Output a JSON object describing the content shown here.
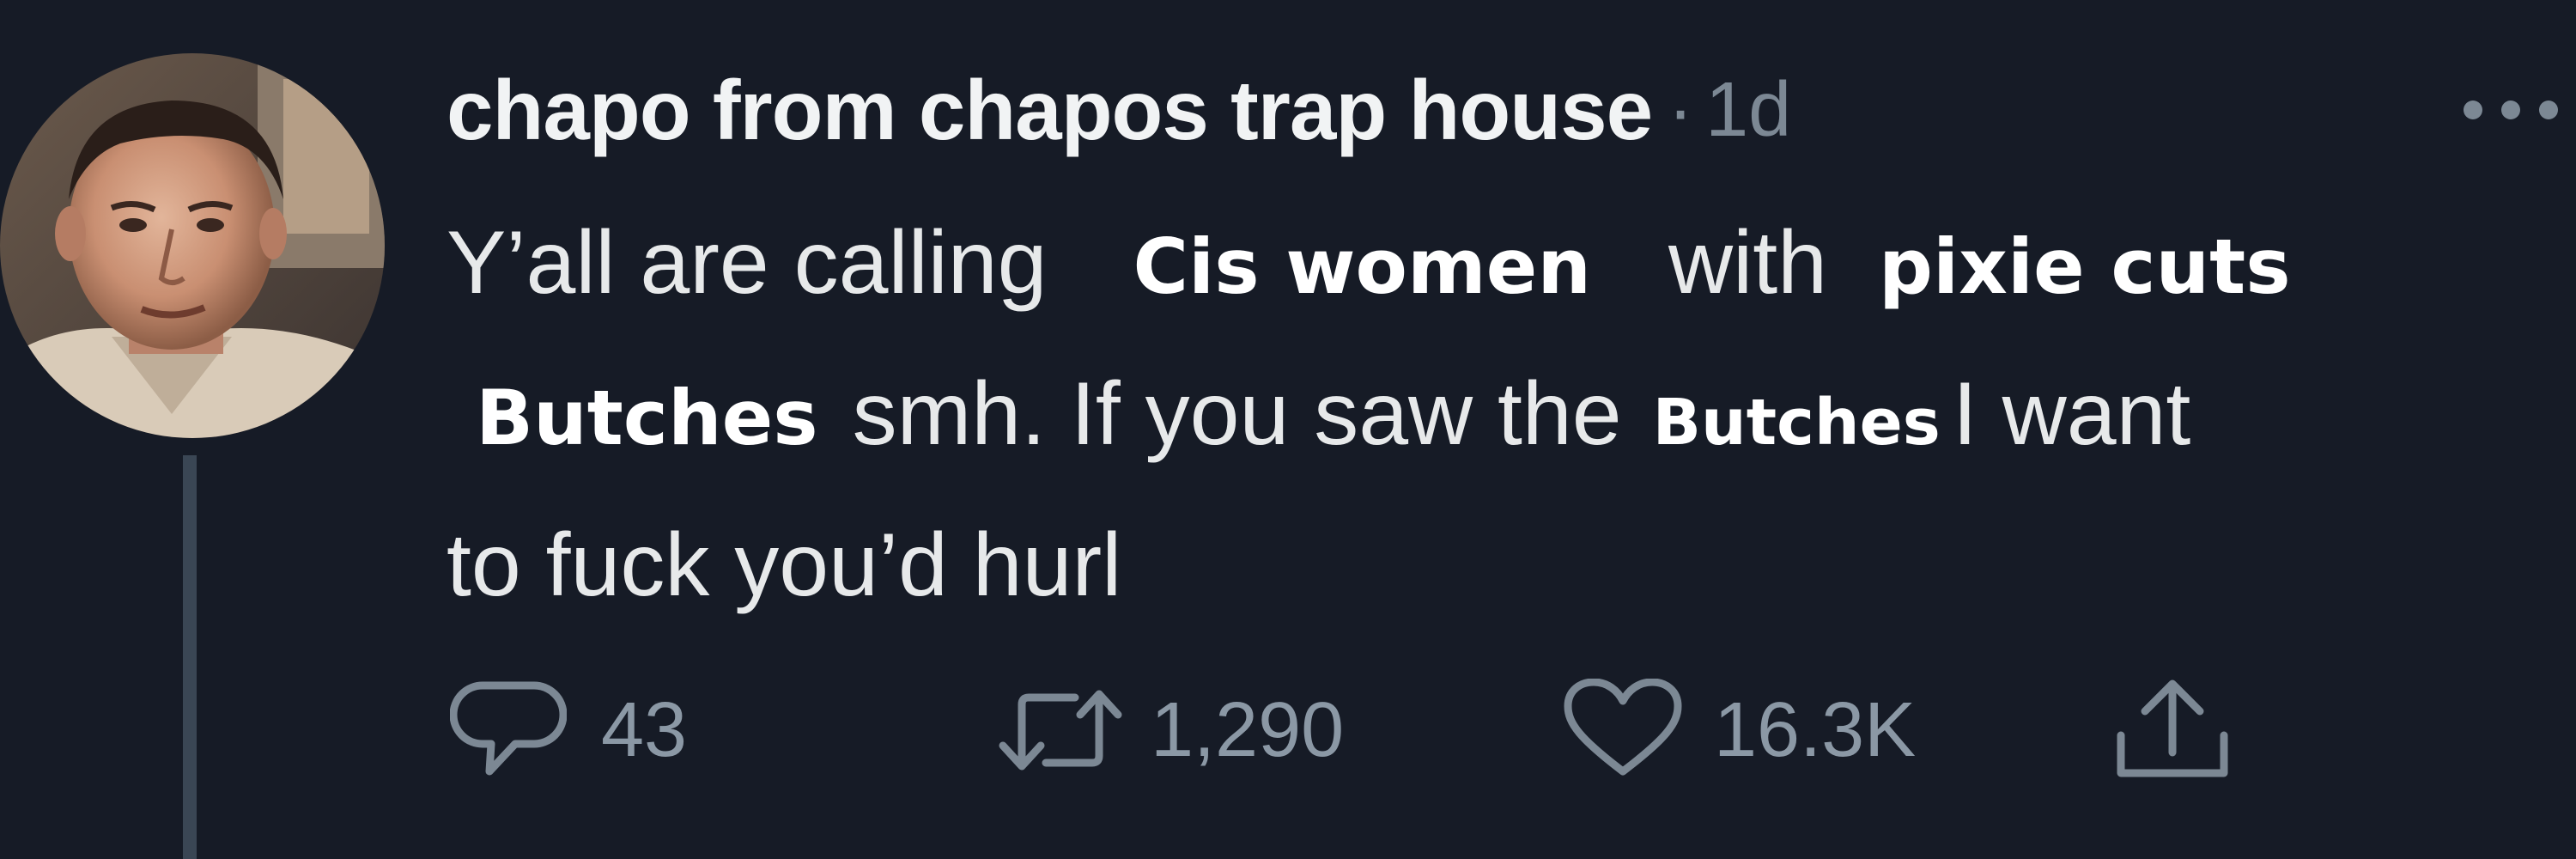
{
  "tweet": {
    "author_name": "chapo from chapos trap house",
    "separator": "·",
    "time": "1d",
    "text_segments": {
      "line1_a": "Y’all are calling",
      "line1_hl1": "Cis women",
      "line1_b": "with",
      "line1_hl2": "pixie cuts",
      "line2_hl1": "Butches",
      "line2_a": "smh. If you saw the",
      "line2_hl2": "Butches",
      "line2_b": "I want",
      "line3": "to fuck you’d hurl"
    },
    "actions": {
      "reply_count": "43",
      "retweet_count": "1,290",
      "like_count": "16.3K"
    }
  },
  "icons": {
    "more": "more-horizontal-icon",
    "reply": "reply-icon",
    "retweet": "retweet-icon",
    "like": "heart-icon",
    "share": "share-icon"
  },
  "colors": {
    "background": "#161b26",
    "text": "#e7e9ea",
    "secondary": "#7c8894",
    "thread_line": "#3a4654"
  }
}
